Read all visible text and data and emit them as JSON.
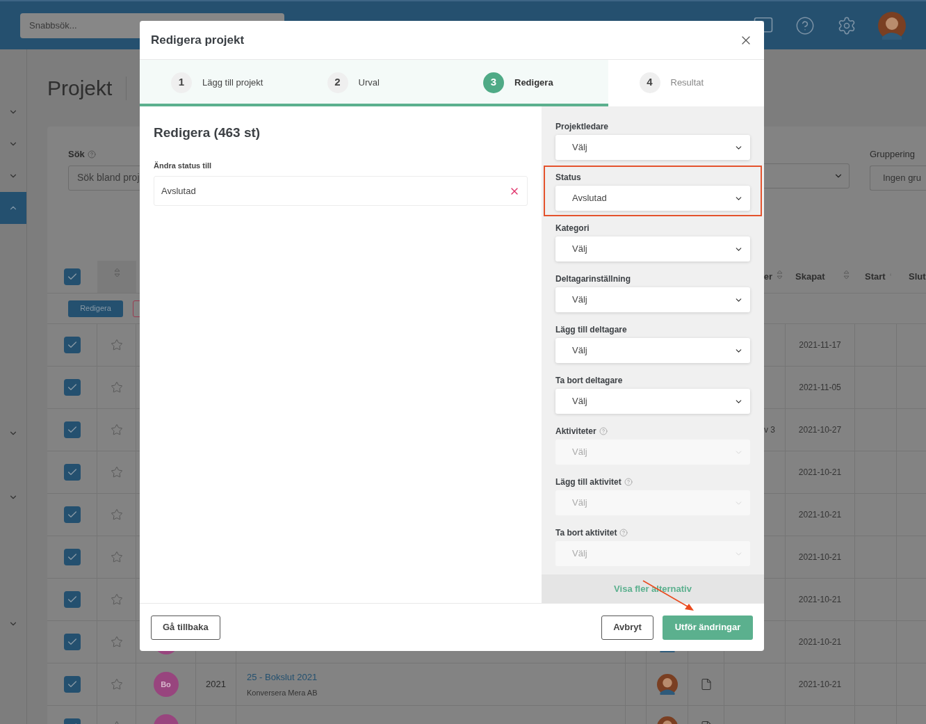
{
  "topbar": {
    "search_placeholder": "Snabbsök..."
  },
  "sidebar": {
    "items": [
      {
        "selected": false,
        "expanded": false
      },
      {
        "selected": false,
        "expanded": false
      },
      {
        "selected": false,
        "expanded": false
      },
      {
        "selected": true,
        "expanded": true
      },
      {
        "selected": false,
        "expanded": false
      },
      {
        "selected": false,
        "expanded": false
      },
      {
        "selected": false,
        "expanded": false
      }
    ]
  },
  "page": {
    "title": "Projekt"
  },
  "filters": {
    "search": {
      "label": "Sök",
      "placeholder": "Sök bland proj"
    },
    "grouping": {
      "label": "Gruppering",
      "value": "Ingen gru"
    }
  },
  "table": {
    "all_selected": true,
    "columns": [
      {
        "label": "er"
      },
      {
        "label": "Skapat"
      },
      {
        "label": "Start"
      },
      {
        "label": "Slut"
      }
    ],
    "bulk_actions": [
      {
        "label": "Redigera"
      }
    ],
    "rows": [
      {
        "checked": true,
        "starred": false,
        "created": "2021-11-17"
      },
      {
        "checked": true,
        "starred": false,
        "created": "2021-11-05"
      },
      {
        "checked": true,
        "starred": false,
        "column_9": "v 3",
        "created": "2021-10-27"
      },
      {
        "checked": true,
        "starred": false,
        "created": "2021-10-21"
      },
      {
        "checked": true,
        "starred": false,
        "created": "2021-10-21"
      },
      {
        "checked": true,
        "starred": false,
        "created": "2021-10-21"
      },
      {
        "checked": true,
        "starred": false,
        "created": "2021-10-21"
      },
      {
        "checked": true,
        "starred": false,
        "badge": true,
        "person": true,
        "created": "2021-10-21"
      },
      {
        "checked": true,
        "starred": false,
        "badge": true,
        "initials": "Bo",
        "year": "2021",
        "title": "25 - Bokslut 2021",
        "client": "Konversera Mera AB",
        "person": true,
        "document": true,
        "created": "2021-10-21"
      },
      {
        "checked": true,
        "starred": false,
        "badge": true,
        "person": true,
        "document": true
      }
    ]
  },
  "modal": {
    "title": "Redigera projekt",
    "steps": [
      {
        "number": "1",
        "label": "Lägg till projekt",
        "reached": true,
        "selected": false
      },
      {
        "number": "2",
        "label": "Urval",
        "reached": true,
        "selected": false
      },
      {
        "number": "3",
        "label": "Redigera",
        "reached": true,
        "selected": true
      },
      {
        "number": "4",
        "label": "Resultat",
        "reached": false,
        "selected": false
      }
    ],
    "heading": "Redigera (463 st)",
    "status_change": {
      "label": "Ändra status till",
      "value": "Avslutad"
    },
    "fields": [
      {
        "label": "Projektledare",
        "value": "Välj",
        "help": false,
        "disabled": false,
        "highlighted": false
      },
      {
        "label": "Status",
        "value": "Avslutad",
        "help": false,
        "disabled": false,
        "highlighted": true
      },
      {
        "label": "Kategori",
        "value": "Välj",
        "help": false,
        "disabled": false,
        "highlighted": false
      },
      {
        "label": "Deltagarinställning",
        "value": "Välj",
        "help": false,
        "disabled": false,
        "highlighted": false
      },
      {
        "label": "Lägg till deltagare",
        "value": "Välj",
        "help": false,
        "disabled": false,
        "highlighted": false
      },
      {
        "label": "Ta bort deltagare",
        "value": "Välj",
        "help": false,
        "disabled": false,
        "highlighted": false
      },
      {
        "label": "Aktiviteter",
        "value": "Välj",
        "help": true,
        "disabled": true,
        "highlighted": false
      },
      {
        "label": "Lägg till aktivitet",
        "value": "Välj",
        "help": true,
        "disabled": true,
        "highlighted": false
      },
      {
        "label": "Ta bort aktivitet",
        "value": "Välj",
        "help": true,
        "disabled": true,
        "highlighted": false
      }
    ],
    "more_options": "Visa fler alternativ",
    "back_button": "Gå tillbaka",
    "cancel_button": "Avbryt",
    "submit_button": "Utför ändringar"
  }
}
